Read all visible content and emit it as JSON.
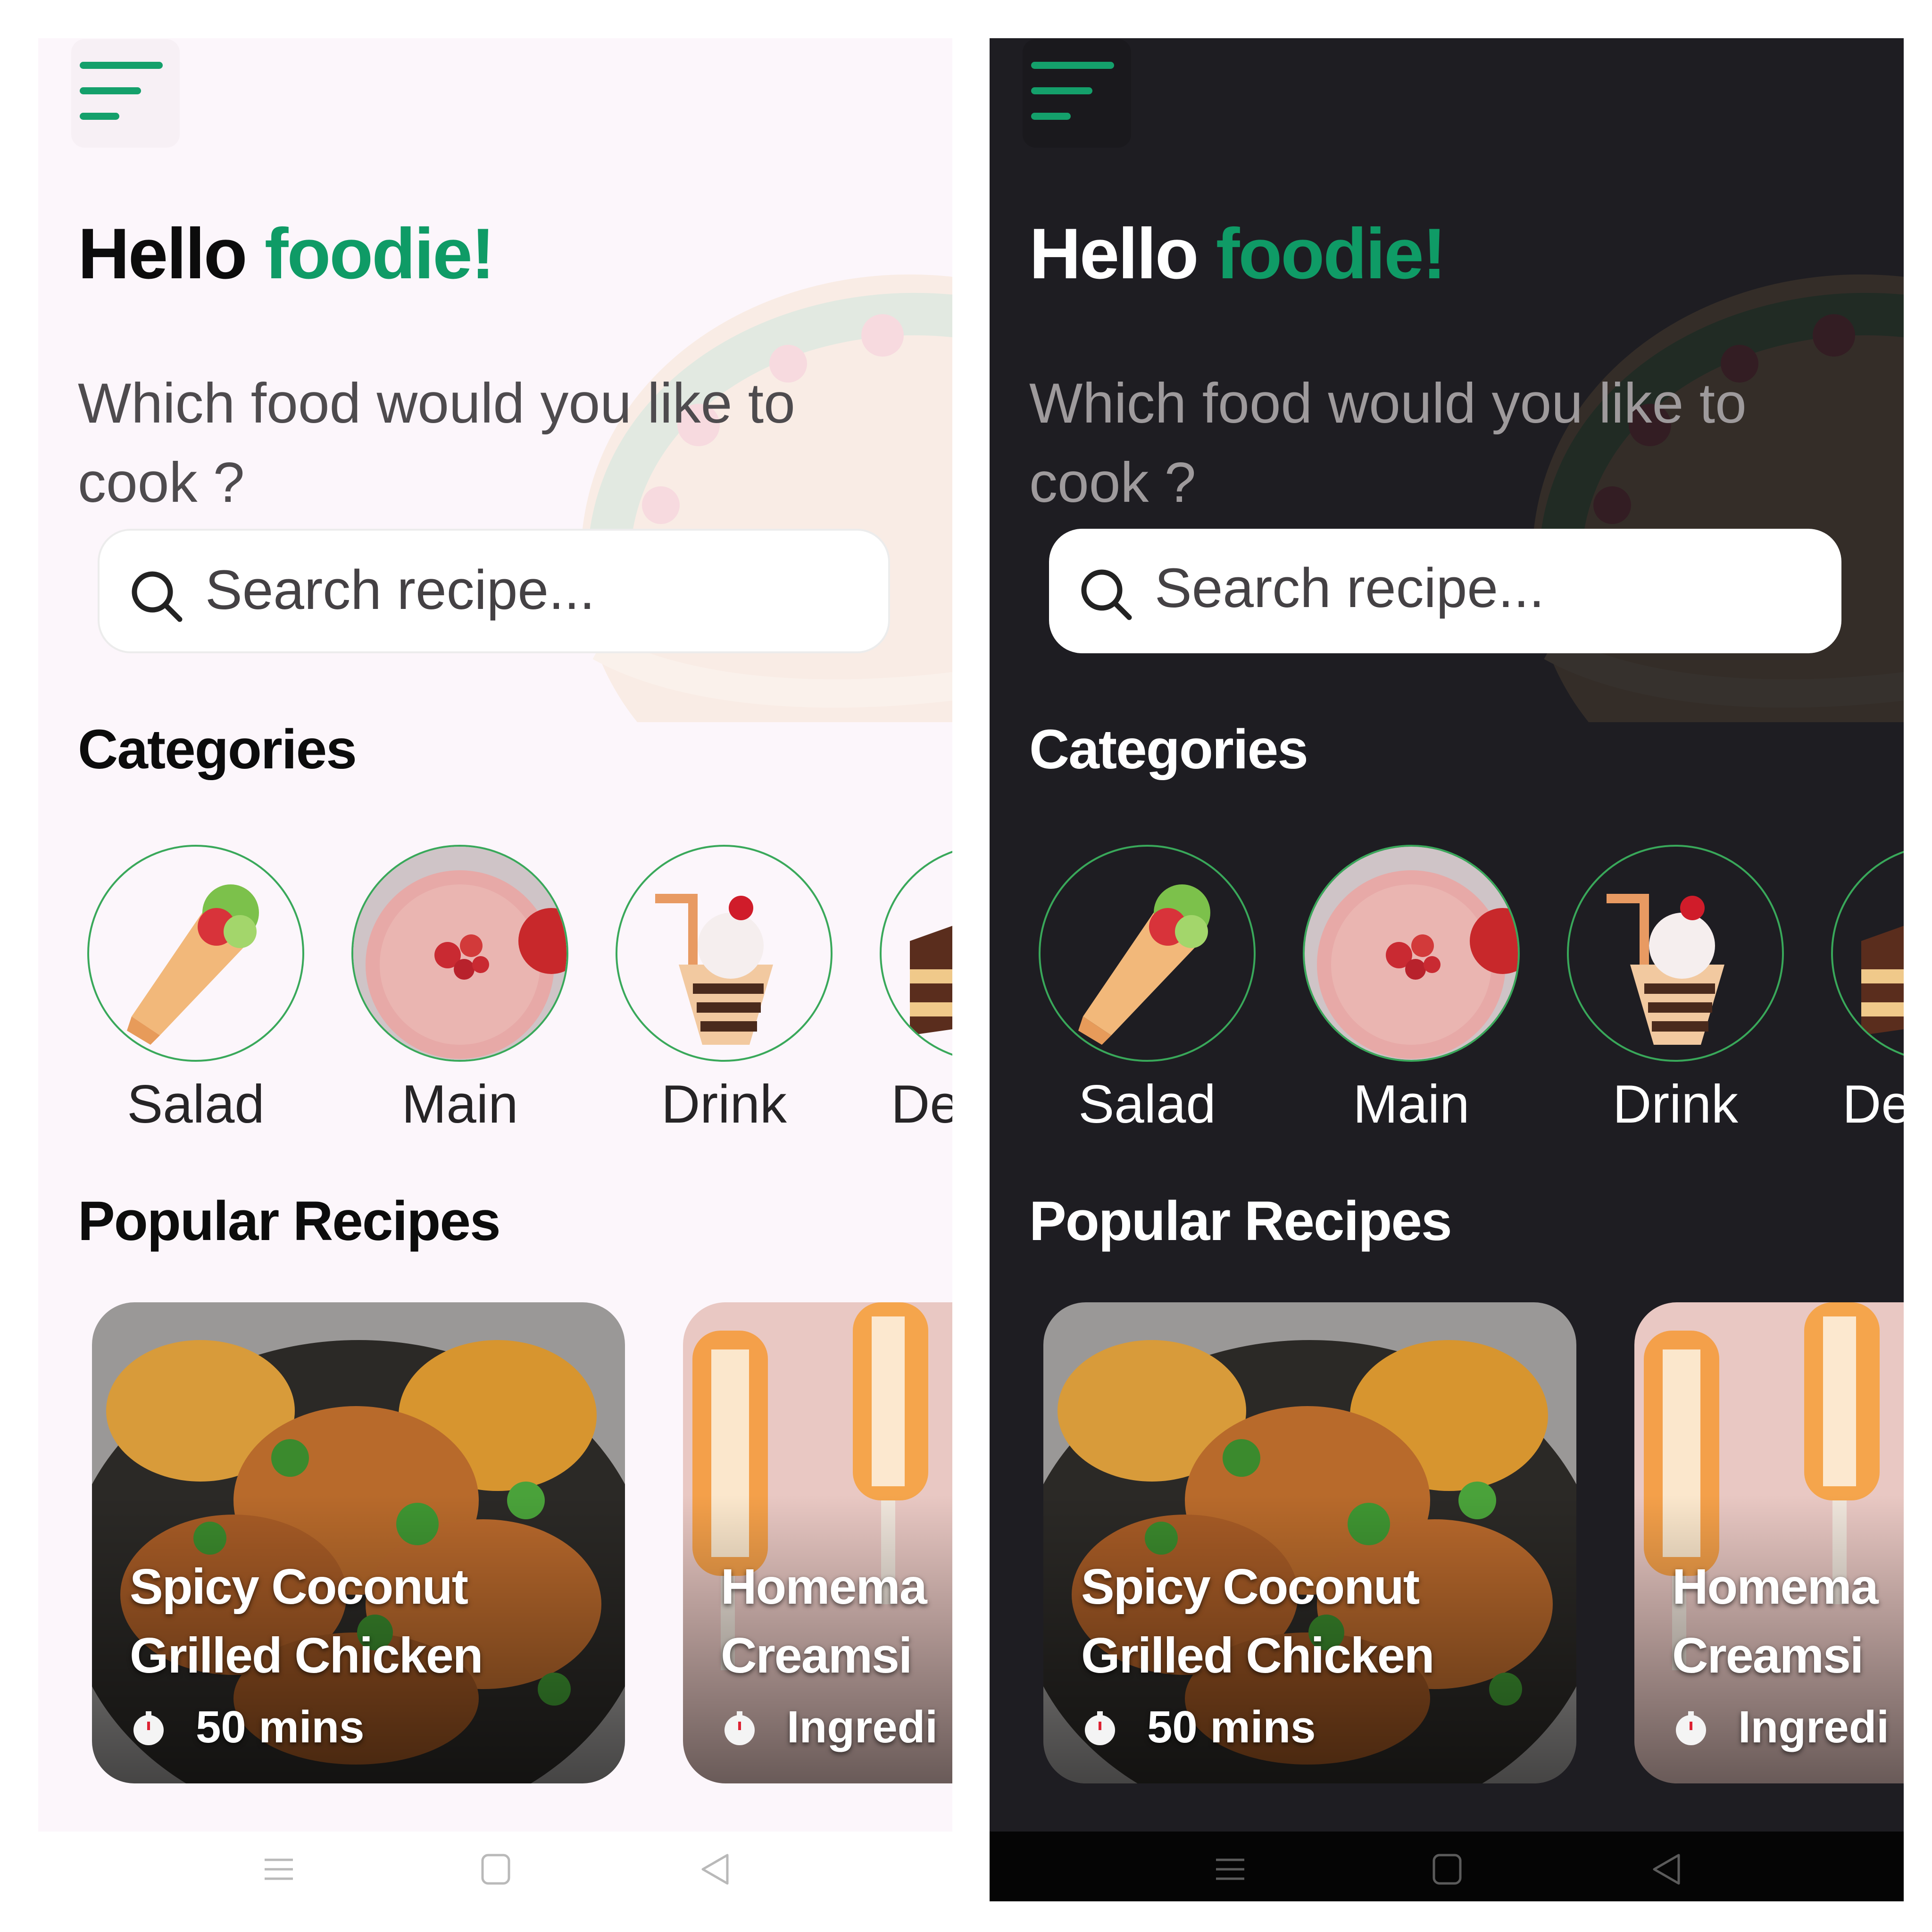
{
  "greeting": {
    "hello": "Hello",
    "accent": "foodie!"
  },
  "subtitle": "Which food would you like to cook ?",
  "search": {
    "placeholder": "Search recipe..."
  },
  "sections": {
    "categories": "Categories",
    "popular": "Popular Recipes"
  },
  "categories": [
    {
      "label": "Salad",
      "icon": "wrap-icon"
    },
    {
      "label": "Main",
      "icon": "smoothie-bowl-icon"
    },
    {
      "label": "Drink",
      "icon": "milkshake-icon"
    },
    {
      "label": "De",
      "icon": "cake-icon"
    }
  ],
  "recipes": [
    {
      "title": "Spicy Coconut\nGrilled Chicken",
      "meta": "50 mins"
    },
    {
      "title": "Homema\nCreamsi",
      "meta": "Ingredi"
    }
  ],
  "colors": {
    "accent": "#0f9b66",
    "border": "#39a85a",
    "light_bg": "#fcf6fb",
    "dark_bg": "#1e1d22"
  }
}
